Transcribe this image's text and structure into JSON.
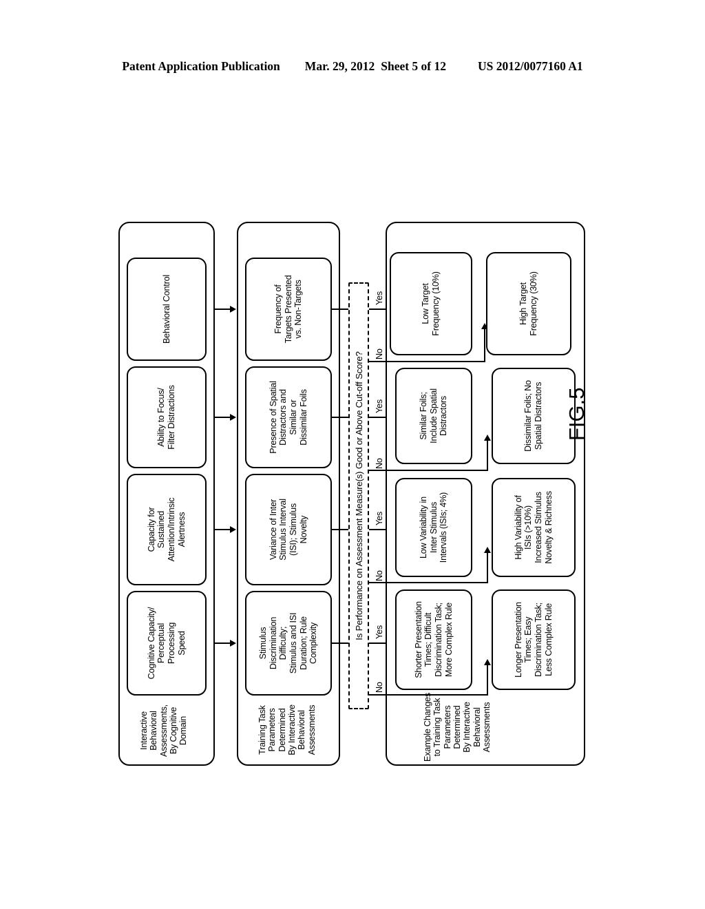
{
  "header": {
    "left": "Patent Application Publication",
    "date": "Mar. 29, 2012",
    "sheet": "Sheet 5 of 12",
    "pub_number": "US 2012/0077160 A1"
  },
  "figure": {
    "caption": "FIG.5"
  },
  "groups": {
    "assessments": {
      "label": "Interactive\nBehavioral\nAssessments,\nBy Cognitive\nDomain"
    },
    "training": {
      "label": "Training Task\nParameters\nDetermined\nBy Interactive\nBehavioral\nAssessments"
    },
    "changes": {
      "label": "Example Changes\nto Training Task\nParameters\nDetermined\nBy Interactive\nBehavioral\nAssessments"
    }
  },
  "decision": {
    "text": "Is Performance on Assessment Measure(s) Good or Above Cut-off Score?",
    "yes_label": "Yes",
    "no_label": "No"
  },
  "assessment_nodes": [
    {
      "id": "cognitive-capacity",
      "text": "Cognitive Capacity/\nPerceptual\nProcessing\nSpeed"
    },
    {
      "id": "sustained-attention",
      "text": "Capacity for\nSustained\nAttention/Intrinsic\nAlertness"
    },
    {
      "id": "focus-filter",
      "text": "Ability to Focus/\nFilter Distractions"
    },
    {
      "id": "behavioral-control",
      "text": "Behavioral Control"
    }
  ],
  "training_nodes": [
    {
      "id": "stimulus-discrimination",
      "text": "Stimulus\nDiscrimination\nDifficulty;\nStimulus and ISI\nDuration; Rule\nComplexity"
    },
    {
      "id": "isi-variance",
      "text": "Variance of Inter\nStimulus Interval\n(ISI); Stimulus\nNovelty"
    },
    {
      "id": "spatial-distractors",
      "text": "Presence of Spatial\nDistractors and\nSimilar or\nDissimilar Foils"
    },
    {
      "id": "target-frequency",
      "text": "Frequency of\nTargets Presented\nvs. Non-Targets"
    }
  ],
  "yes_nodes": [
    {
      "id": "shorter-presentation",
      "text": "Shorter Presentation\nTimes; Difficult\nDiscrimination Task;\nMore Complex Rule"
    },
    {
      "id": "low-isi-variability",
      "text": "Low Variability in\nInter Stimulus\nIntervals (ISIs; 4%)"
    },
    {
      "id": "similar-foils",
      "text": "Similar Foils;\nInclude Spatial\nDistractors"
    },
    {
      "id": "low-target-frequency",
      "text": "Low Target\nFrequency (10%)"
    }
  ],
  "no_nodes": [
    {
      "id": "longer-presentation",
      "text": "Longer Presentation\nTimes; Easy\nDiscrimination Task;\nLess Complex Rule"
    },
    {
      "id": "high-isi-variability",
      "text": "High Variability of\nISIs (>10%)\nIncreased Stimulus\nNovelty & Richness"
    },
    {
      "id": "dissimilar-foils",
      "text": "Dissimilar Foils; No\nSpatial Distractors"
    },
    {
      "id": "high-target-frequency",
      "text": "High Target\nFrequency (30%)"
    }
  ],
  "colors": {
    "ink": "#000000",
    "paper": "#ffffff"
  }
}
